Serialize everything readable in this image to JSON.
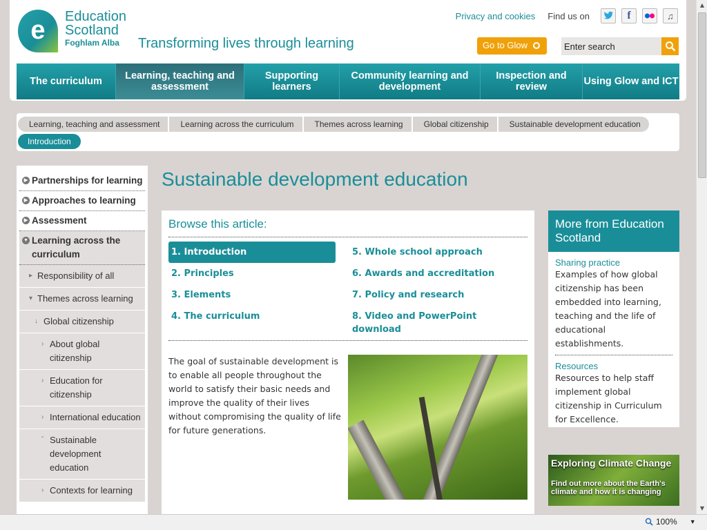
{
  "header": {
    "logo_line1": "Education",
    "logo_line2": "Scotland",
    "logo_line3": "Foghlam Alba",
    "tagline": "Transforming lives through learning",
    "privacy_link": "Privacy and cookies",
    "find_us": "Find us on",
    "glow_button": "Go to Glow",
    "search_placeholder": "Enter search"
  },
  "nav": {
    "items": [
      {
        "label": "The curriculum"
      },
      {
        "label": "Learning, teaching and assessment"
      },
      {
        "label": "Supporting learners"
      },
      {
        "label": "Community learning and development"
      },
      {
        "label": "Inspection and review"
      },
      {
        "label": "Using Glow and ICT"
      }
    ]
  },
  "breadcrumb": {
    "items": [
      "Learning, teaching and assessment",
      "Learning across the curriculum",
      "Themes across learning",
      "Global citizenship",
      "Sustainable development education"
    ],
    "current": "Introduction"
  },
  "leftnav": {
    "items": [
      "Partnerships for learning",
      "Approaches to learning",
      "Assessment",
      "Learning across the curriculum"
    ],
    "sub": {
      "responsibility": "Responsibility of all",
      "themes": "Themes across learning",
      "global": "Global citizenship",
      "about": "About global citizenship",
      "education": "Education for citizenship",
      "international": "International education",
      "sustainable": "Sustainable development education",
      "contexts": "Contexts for learning"
    }
  },
  "main": {
    "title": "Sustainable development education",
    "browse_heading": "Browse this article:",
    "toc_left": [
      "1. Introduction",
      "2. Principles",
      "3. Elements",
      "4. The curriculum"
    ],
    "toc_right": [
      "5. Whole school approach",
      "6. Awards and accreditation",
      "7. Policy and research",
      "8. Video and PowerPoint download"
    ],
    "intro": "The goal of sustainable development is to enable all people throughout the world to satisfy their basic needs and improve the quality of their lives without compromising the quality of life for future generations."
  },
  "sidebar": {
    "heading": "More from Education Scotland",
    "sharing_link": "Sharing practice",
    "sharing_text": "Examples of how global citizenship has been embedded into learning, teaching and the life of educational establishments.",
    "resources_link": "Resources",
    "resources_text": "Resources to help staff implement global citizenship in Curriculum for Excellence.",
    "climate_title": "Exploring Climate Change",
    "climate_text": "Find out more about the Earth's climate and how it is changing"
  },
  "status": {
    "zoom": "100%"
  },
  "colors": {
    "brand_teal": "#1a8e98",
    "glow_orange": "#f0a10a"
  }
}
